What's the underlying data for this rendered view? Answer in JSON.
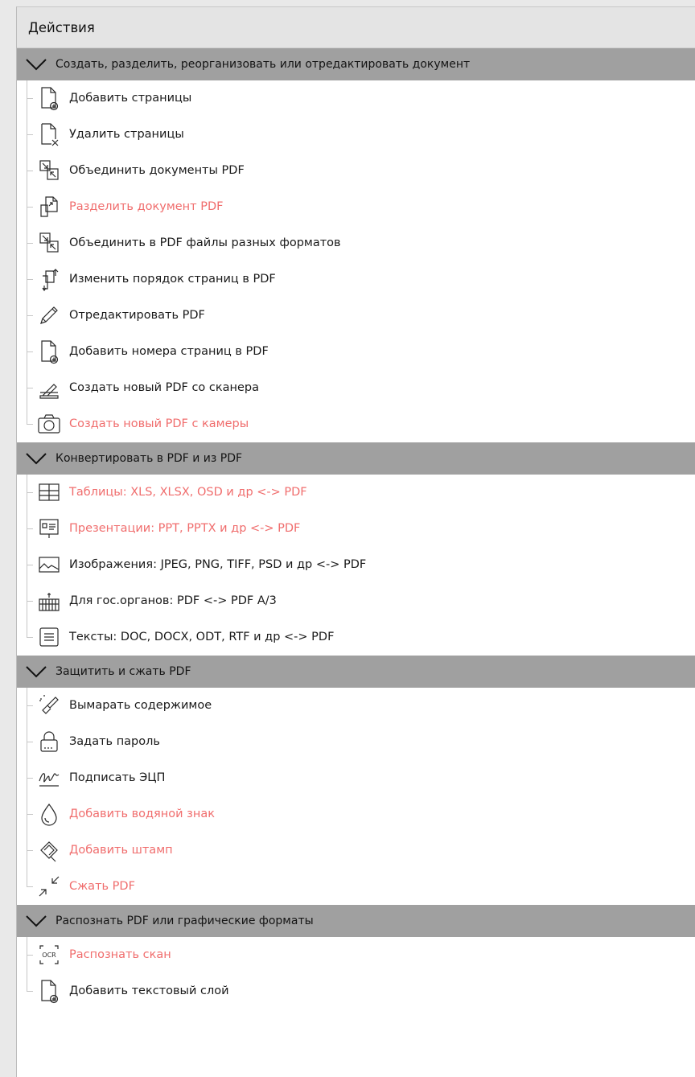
{
  "panel": {
    "title": "Действия"
  },
  "colors": {
    "accent": "#f06d6d",
    "group_header_bg": "#a0a0a0",
    "panel_title_bg": "#e4e4e4"
  },
  "groups": [
    {
      "title": "Создать, разделить, реорганизовать или отредактировать документ",
      "items": [
        {
          "label": "Добавить страницы",
          "icon": "add-page-icon",
          "accent": false
        },
        {
          "label": "Удалить страницы",
          "icon": "delete-page-icon",
          "accent": false
        },
        {
          "label": "Объединить документы PDF",
          "icon": "merge-icon",
          "accent": false
        },
        {
          "label": "Разделить документ PDF",
          "icon": "split-icon",
          "accent": true
        },
        {
          "label": "Объединить в PDF файлы разных форматов",
          "icon": "merge-formats-icon",
          "accent": false
        },
        {
          "label": "Изменить порядок страниц в PDF",
          "icon": "reorder-pages-icon",
          "accent": false
        },
        {
          "label": "Отредактировать PDF",
          "icon": "pencil-icon",
          "accent": false
        },
        {
          "label": "Добавить номера страниц в PDF",
          "icon": "page-numbers-icon",
          "accent": false
        },
        {
          "label": "Создать новый PDF со сканера",
          "icon": "scanner-icon",
          "accent": false
        },
        {
          "label": "Создать новый PDF с камеры",
          "icon": "camera-icon",
          "accent": true
        }
      ]
    },
    {
      "title": "Конвертировать в PDF и из PDF",
      "items": [
        {
          "label": "Таблицы: XLS, XLSX, OSD и др <-> PDF",
          "icon": "table-icon",
          "accent": true
        },
        {
          "label": "Презентации: PPT, PPTX и др <-> PDF",
          "icon": "presentation-icon",
          "accent": true
        },
        {
          "label": "Изображения: JPEG, PNG, TIFF, PSD и др <-> PDF",
          "icon": "image-icon",
          "accent": false
        },
        {
          "label": "Для гос.органов: PDF <-> PDF A/3",
          "icon": "government-icon",
          "accent": false
        },
        {
          "label": "Тексты: DOC, DOCX, ODT, RTF и др <-> PDF",
          "icon": "text-document-icon",
          "accent": false
        }
      ]
    },
    {
      "title": "Защитить и сжать PDF",
      "items": [
        {
          "label": "Вымарать содержимое",
          "icon": "redact-brush-icon",
          "accent": false
        },
        {
          "label": "Задать пароль",
          "icon": "lock-icon",
          "accent": false
        },
        {
          "label": "Подписать ЭЦП",
          "icon": "signature-icon",
          "accent": false
        },
        {
          "label": "Добавить водяной знак",
          "icon": "water-drop-icon",
          "accent": true
        },
        {
          "label": "Добавить штамп",
          "icon": "stamp-icon",
          "accent": true
        },
        {
          "label": "Сжать PDF",
          "icon": "compress-icon",
          "accent": true
        }
      ]
    },
    {
      "title": "Распознать PDF или графические форматы",
      "items": [
        {
          "label": "Распознать скан",
          "icon": "ocr-icon",
          "accent": true
        },
        {
          "label": "Добавить текстовый слой",
          "icon": "add-text-layer-icon",
          "accent": false
        }
      ]
    }
  ]
}
